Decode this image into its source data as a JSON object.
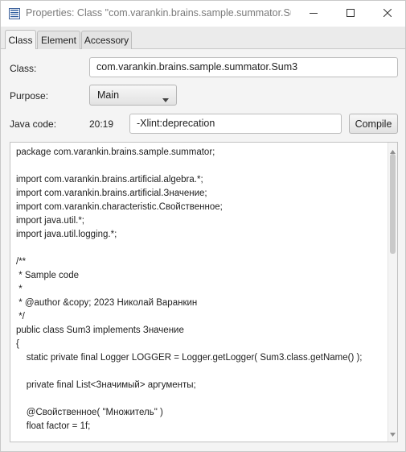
{
  "window": {
    "title": "Properties: Class \"com.varankin.brains.sample.summator.Su...",
    "icons": {
      "app": "properties-window-icon",
      "minimize": "minimize-icon",
      "maximize": "maximize-icon",
      "close": "close-icon"
    }
  },
  "tabs": [
    {
      "label": "Class",
      "active": true
    },
    {
      "label": "Element",
      "active": false
    },
    {
      "label": "Accessory",
      "active": false
    }
  ],
  "form": {
    "class_label": "Class:",
    "class_value": "com.varankin.brains.sample.summator.Sum3",
    "purpose_label": "Purpose:",
    "purpose_value": "Main",
    "javacode_label": "Java code:",
    "cursor_position": "20:19",
    "compiler_options": "-Xlint:deprecation",
    "compile_label": "Compile"
  },
  "code": {
    "lines": [
      "package com.varankin.brains.sample.summator;",
      "",
      "import com.varankin.brains.artificial.algebra.*;",
      "import com.varankin.brains.artificial.Значение;",
      "import com.varankin.characteristic.Свойственное;",
      "import java.util.*;",
      "import java.util.logging.*;",
      "",
      "/**",
      " * Sample code",
      " *",
      " * @author &copy; 2023 Николай Варанкин",
      " */",
      "public class Sum3 implements Значение",
      "{",
      "    static private final Logger LOGGER = Logger.getLogger( Sum3.class.getName() );",
      "",
      "    private final List<Значимый> аргументы;",
      "",
      "    @Свойственное( \"Множитель\" )",
      "    float factor = 1f;"
    ]
  }
}
